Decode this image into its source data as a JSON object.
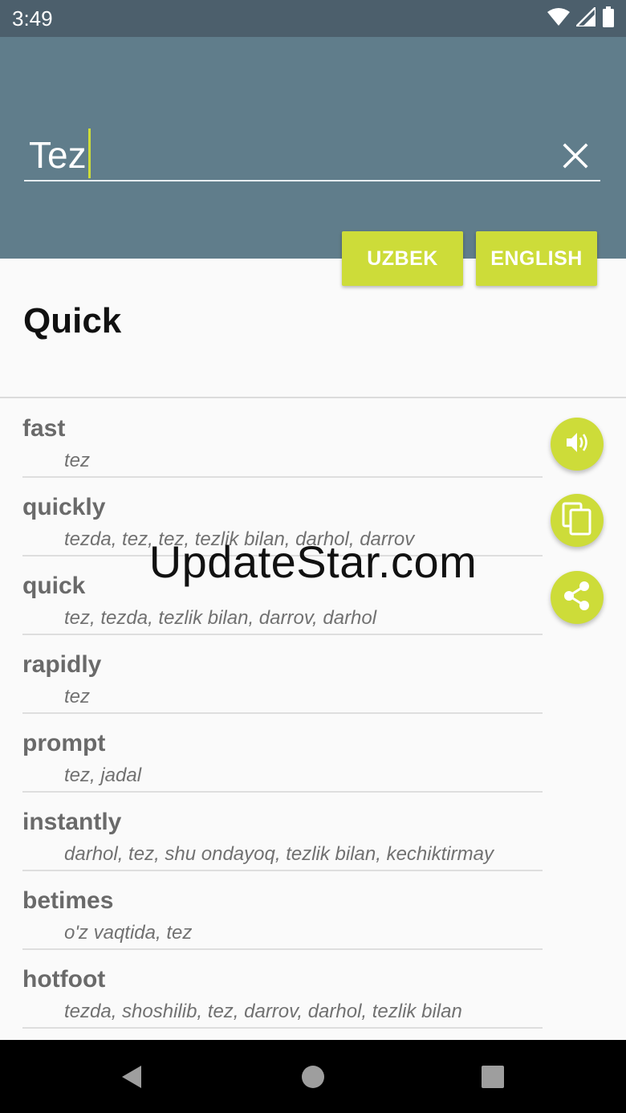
{
  "status_bar": {
    "time": "3:49",
    "icons": [
      "wifi-icon",
      "signal-icon",
      "battery-icon"
    ]
  },
  "search": {
    "value": "Tez",
    "clear_icon": "close-icon"
  },
  "language_buttons": {
    "uzbek": "UZBEK",
    "english": "ENGLISH"
  },
  "word": {
    "title": "Quick"
  },
  "results": [
    {
      "term": "fast",
      "translation": "tez"
    },
    {
      "term": "quickly",
      "translation": "tezda, tez, tez, tezlik bilan, darhol, darrov"
    },
    {
      "term": "quick",
      "translation": "tez, tezda, tezlik bilan, darrov, darhol"
    },
    {
      "term": "rapidly",
      "translation": "tez"
    },
    {
      "term": "prompt",
      "translation": "tez, jadal"
    },
    {
      "term": "instantly",
      "translation": "darhol, tez, shu ondayoq, tezlik bilan, kechiktirmay"
    },
    {
      "term": "betimes",
      "translation": "o'z vaqtida, tez"
    },
    {
      "term": "hotfoot",
      "translation": "tezda, shoshilib, tez, darrov, darhol, tezlik bilan"
    }
  ],
  "actions": {
    "icons": [
      "speaker-icon",
      "copy-icon",
      "share-icon"
    ]
  },
  "watermark": "UpdateStar.com",
  "colors": {
    "primary": "#607d8b",
    "status_bar": "#4c5f6c",
    "accent": "#cddc39",
    "background": "#fafafa"
  }
}
